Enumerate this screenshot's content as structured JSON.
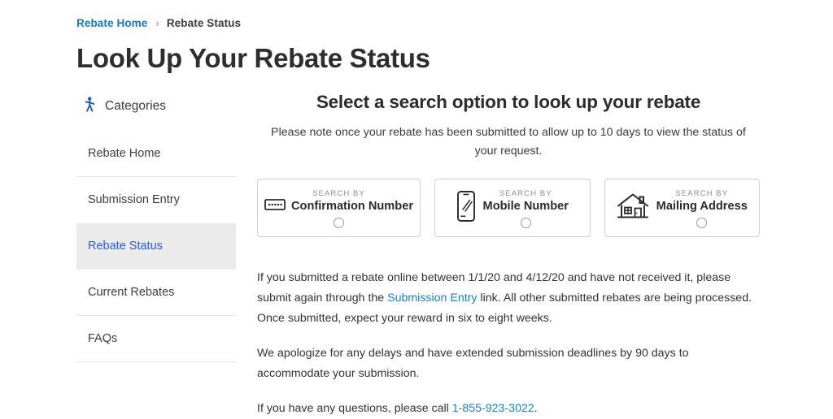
{
  "breadcrumb": {
    "home_label": "Rebate Home",
    "separator": "›",
    "current_label": "Rebate Status"
  },
  "page_title": "Look Up Your Rebate Status",
  "sidebar": {
    "heading": "Categories",
    "heading_icon": "person-walking-icon",
    "items": [
      {
        "label": "Rebate Home",
        "active": false
      },
      {
        "label": "Submission Entry",
        "active": false
      },
      {
        "label": "Rebate Status",
        "active": true
      },
      {
        "label": "Current Rebates",
        "active": false
      },
      {
        "label": "FAQs",
        "active": false
      }
    ]
  },
  "main": {
    "title": "Select a search option to look up your rebate",
    "note": "Please note once your rebate has been submitted to allow up to 10 days to view the status of your request.",
    "options": [
      {
        "kicker": "SEARCH BY",
        "title": "Confirmation Number",
        "icon": "confirmation-code-icon",
        "icon_position": "inline-left-of-title",
        "selected": false
      },
      {
        "kicker": "SEARCH BY",
        "title": "Mobile Number",
        "icon": "mobile-phone-icon",
        "icon_position": "left",
        "selected": false
      },
      {
        "kicker": "SEARCH BY",
        "title": "Mailing Address",
        "icon": "house-icon",
        "icon_position": "left",
        "selected": false
      }
    ],
    "paragraphs": {
      "p1_part1": "If you submitted a rebate online between 1/1/20 and 4/12/20 and have not received it, please submit again through the ",
      "p1_link": "Submission Entry",
      "p1_part2": " link. All other submitted rebates are being processed. Once submitted, expect your reward in six to eight weeks.",
      "p2": "We apologize for any delays and have extended submission deadlines by 90 days to accommodate your submission.",
      "p3_part1": "If you have any questions, please call ",
      "p3_link": "1-855-923-3022",
      "p3_part2": "."
    }
  },
  "colors": {
    "breadcrumb_link": "#1577bd",
    "sidebar_active_text": "#2f5bd4",
    "sidebar_active_bg": "#ebebeb",
    "inline_link": "#1b7ec4",
    "card_border": "#cfcfcf"
  }
}
